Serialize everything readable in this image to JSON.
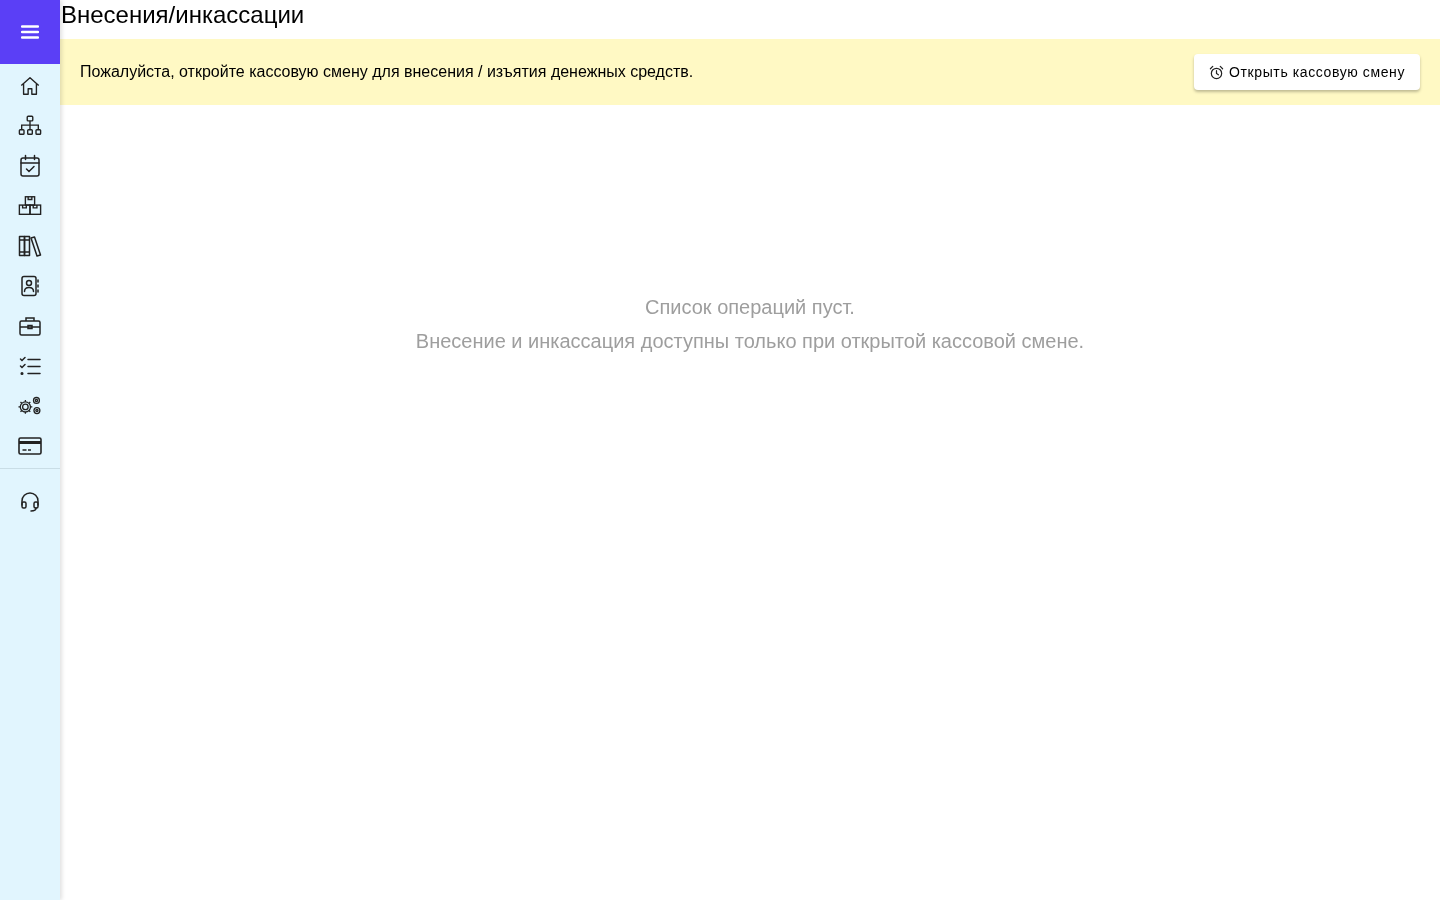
{
  "page": {
    "title": "Внесения/инкассации"
  },
  "notice": {
    "text": "Пожалуйста, откройте кассовую смену для внесения / изъятия денежных средств.",
    "button": "Открыть кассовую смену"
  },
  "empty_state": {
    "lines": [
      "Список операций пуст.",
      "Внесение и инкассация доступны только при открытой кассовой смене."
    ]
  }
}
